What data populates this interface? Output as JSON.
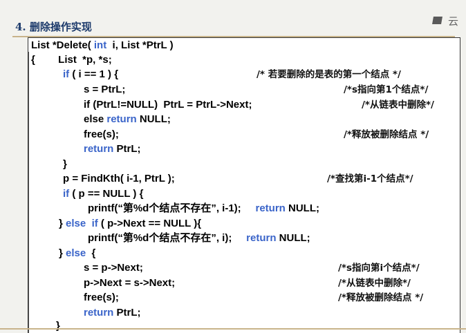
{
  "title": "4. 删除操作实现",
  "corner_label": "云",
  "code": {
    "l1": {
      "a": "List *Delete( ",
      "kw": "int",
      "b": "  i, List *PtrL )"
    },
    "l2": {
      "a": "{        List  *p, *s;"
    },
    "l3": {
      "kw": "if",
      "b": " ( i == 1 ) {"
    },
    "l4": {
      "a": "s = PtrL;"
    },
    "l5": {
      "a": "if (PtrL!=NULL)  PtrL = PtrL->Next;"
    },
    "l6": {
      "a": "else ",
      "kw": "return",
      "b": " NULL;"
    },
    "l7": {
      "a": "free(s);"
    },
    "l8": {
      "kw": "return",
      "b": " PtrL;"
    },
    "l9": {
      "a": "}"
    },
    "l10": {
      "a": "p = FindKth( i-1, PtrL );"
    },
    "l11": {
      "kw": "if",
      "b": " ( p == NULL ) {"
    },
    "l12": {
      "a": "printf(“第%d个结点不存在”, i-1);     ",
      "kw": "return",
      "b": " NULL;"
    },
    "l13": {
      "a": "} ",
      "kw": "else",
      "kw2": "if",
      "b": " ( p->Next == NULL ){"
    },
    "l14": {
      "a": "printf(“第%d个结点不存在”, i);     ",
      "kw": "return",
      "b": " NULL;"
    },
    "l15": {
      "a": "} ",
      "kw": "else",
      "b": "  {"
    },
    "l16": {
      "a": "s = p->Next;"
    },
    "l17": {
      "a": "p->Next = s->Next;"
    },
    "l18": {
      "a": "free(s);"
    },
    "l19": {
      "kw": "return",
      "b": " PtrL;"
    },
    "l20": {
      "a": "}"
    }
  },
  "comments": {
    "c3": "/* 若要删除的是表的第一个结点 */",
    "c4": "/*s指向第1个结点*/",
    "c5": "/*从链表中删除*/",
    "c7": "/*释放被删除结点 */",
    "c10": "/*查找第i-1个结点*/",
    "c16": "/*s指向第i个结点*/",
    "c17": "/*从链表中删除*/",
    "c18": "/*释放被删除结点 */"
  }
}
